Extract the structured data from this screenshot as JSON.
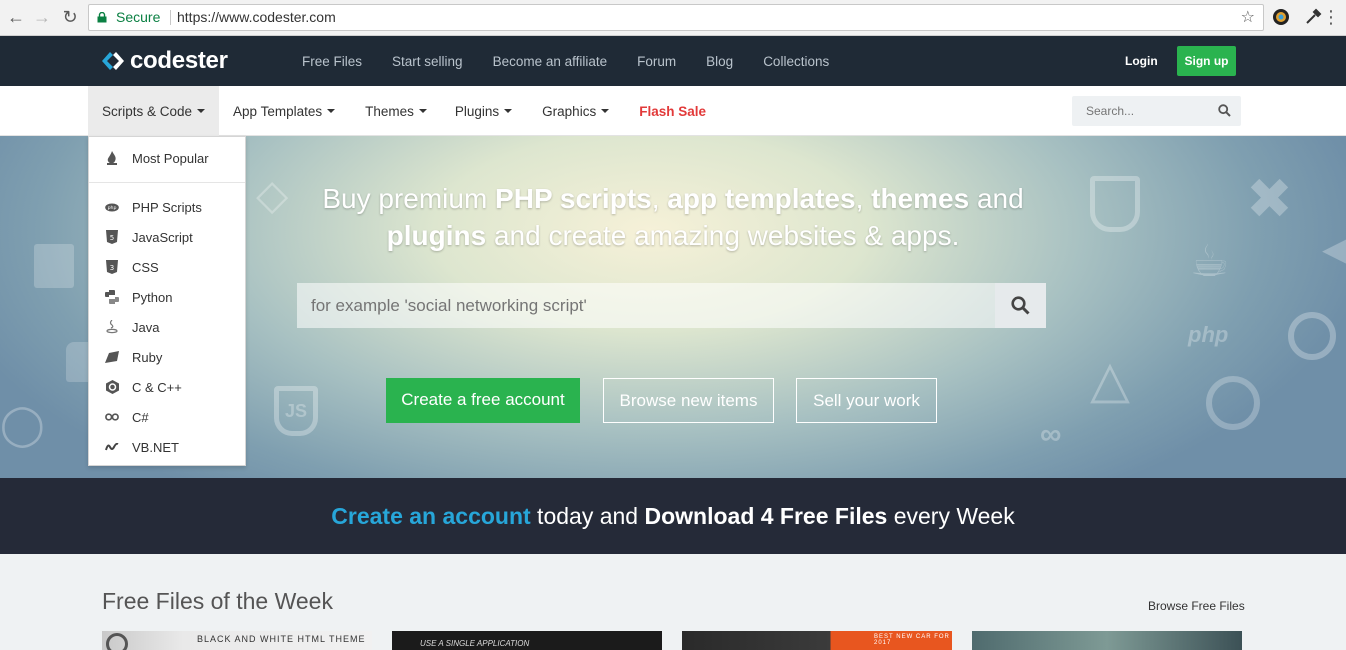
{
  "browser": {
    "secure_label": "Secure",
    "url": "https://www.codester.com"
  },
  "brand": {
    "name": "codester",
    "accent": "#27a6d9",
    "nav_bg": "#1f2a36",
    "green": "#2ab34f"
  },
  "topnav": {
    "links": [
      "Free Files",
      "Start selling",
      "Become an affiliate",
      "Forum",
      "Blog",
      "Collections"
    ],
    "login": "Login",
    "signup": "Sign up"
  },
  "subnav": {
    "items": [
      "Scripts & Code",
      "App Templates",
      "Themes",
      "Plugins",
      "Graphics"
    ],
    "flash_sale": "Flash Sale",
    "search_placeholder": "Search..."
  },
  "dropdown": {
    "top_item": {
      "label": "Most Popular",
      "icon": "flame-icon"
    },
    "items": [
      {
        "label": "PHP Scripts",
        "icon": "php-icon"
      },
      {
        "label": "JavaScript",
        "icon": "js-icon"
      },
      {
        "label": "CSS",
        "icon": "css-icon"
      },
      {
        "label": "Python",
        "icon": "python-icon"
      },
      {
        "label": "Java",
        "icon": "java-icon"
      },
      {
        "label": "Ruby",
        "icon": "ruby-icon"
      },
      {
        "label": "C & C++",
        "icon": "cpp-icon"
      },
      {
        "label": "C#",
        "icon": "csharp-icon"
      },
      {
        "label": "VB.NET",
        "icon": "vbnet-icon"
      }
    ]
  },
  "hero": {
    "t1": "Buy premium ",
    "t2": "PHP scripts",
    "t3": ", ",
    "t4": "app templates",
    "t5": ", ",
    "t6": "themes",
    "t7": " and",
    "t8": "plugins",
    "t9": " and create amazing websites & apps.",
    "search_placeholder": "for example 'social networking script'",
    "btn_create": "Create a free account",
    "btn_browse": "Browse new items",
    "btn_sell": "Sell your work"
  },
  "banner": {
    "p1": "Create an account",
    "p2": " today and ",
    "p3": "Download 4 Free Files",
    "p4": " every Week"
  },
  "free_files": {
    "title": "Free Files of the Week",
    "browse": "Browse Free Files",
    "thumb1": "BLACK AND WHITE HTML THEME",
    "thumb2": "USE A SINGLE APPLICATION",
    "thumb3": "BEST NEW CAR FOR 2017"
  }
}
